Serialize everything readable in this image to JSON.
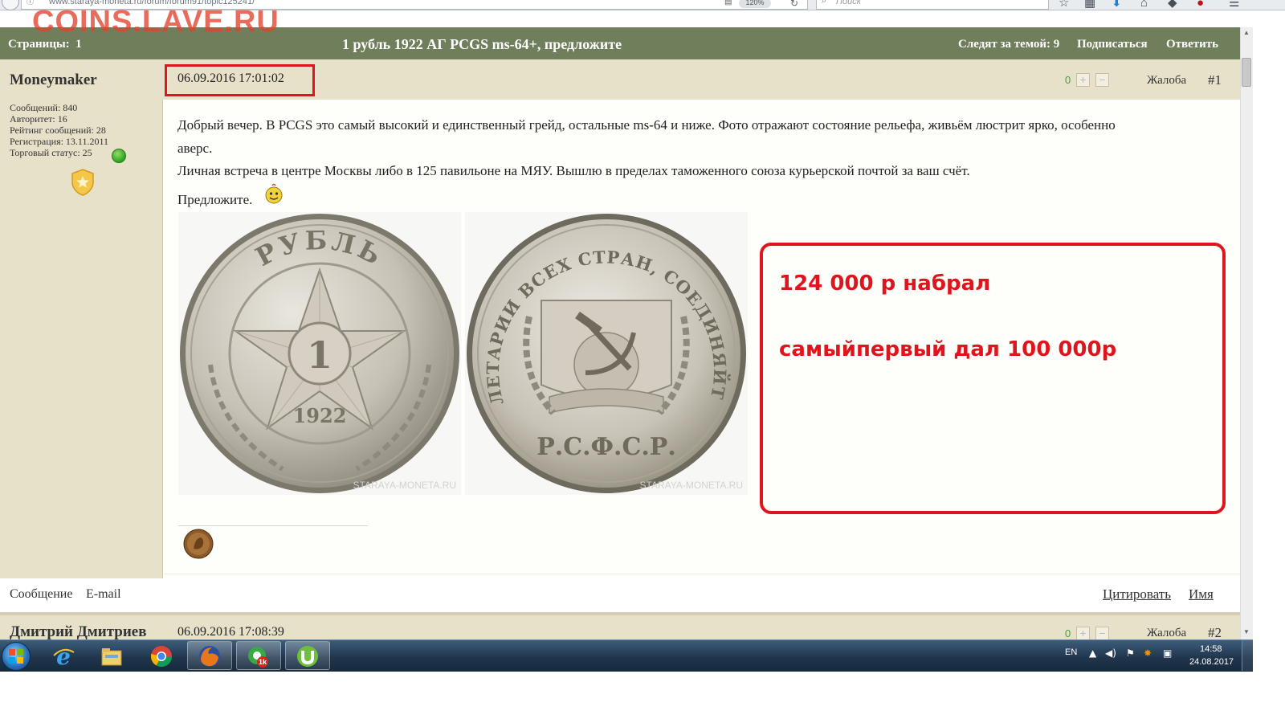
{
  "browser": {
    "url": "www.staraya-moneta.ru/forum/forum91/topic125241/",
    "zoom": "120%",
    "search_placeholder": "Поиск"
  },
  "watermark": "COINS.LAVE.RU",
  "topic": {
    "pages_label": "Страницы:",
    "current_page": "1",
    "title": "1 рубль 1922 АГ PCGS ms-64+, предложите",
    "watchers": "Следят за темой: 9",
    "subscribe": "Подписаться",
    "reply": "Ответить"
  },
  "post": {
    "author": "Moneymaker",
    "stats": {
      "messages": "Сообщений: 840",
      "authority": "Авторитет: 16",
      "rating": "Рейтинг сообщений: 28",
      "registration": "Регистрация: 13.11.2011",
      "trade_status": "Торговый статус: 25"
    },
    "date": "06.09.2016 17:01:02",
    "votes": "0",
    "vote_plus": "+",
    "vote_minus": "−",
    "complaint": "Жалоба",
    "number": "#1",
    "lines": [
      "Добрый вечер. В PCGS это самый высокий и единственный грейд, остальные ms-64 и ниже. Фото отражают состояние рельефа, живьём люстрит ярко, особенно",
      "аверс.",
      "Личная встреча в центре Москвы либо в 125 павильоне на МЯУ. Вышлю в пределах таможенного союза курьерской почтой за ваш счёт.",
      "Предложите."
    ],
    "photo_watermark": "STARAYA-MONETA.RU",
    "obverse": {
      "top_text": "РУБЛЬ",
      "denomination": "1",
      "year": "1922"
    },
    "reverse": {
      "legend": "ПРОЛЕТАРИИ ВСЕХ СТРАН, СОЕДИНЯЙТЕСЬ!",
      "country": "Р.С.Ф.С.Р."
    },
    "footer": {
      "message": "Сообщение",
      "email": "E-mail",
      "quote": "Цитировать",
      "name": "Имя"
    }
  },
  "annotation": {
    "line1": "124 000 р набрал",
    "line2": "самыйпервый дал 100 000р",
    "color": "#e0141c"
  },
  "post2": {
    "author": "Дмитрий Дмитриев",
    "date": "06.09.2016 17:08:39",
    "votes": "0",
    "complaint": "Жалоба",
    "number": "#2"
  },
  "taskbar": {
    "apps": [
      "windows-start",
      "internet-explorer",
      "file-explorer",
      "chrome",
      "firefox",
      "icq",
      "utorrent"
    ],
    "icq_badge": "1k",
    "language": "EN",
    "time": "14:58",
    "date": "24.08.2017"
  },
  "colors": {
    "header_bar": "#6f7f5b",
    "post_panel": "#e7e1c9",
    "highlight_red": "#e0141c",
    "vote_green": "#3aa43a"
  }
}
